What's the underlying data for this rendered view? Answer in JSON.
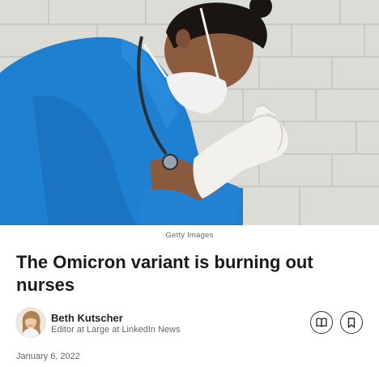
{
  "article": {
    "image_caption": "Getty Images",
    "title": "The Omicron variant is burning out nurses",
    "author": {
      "name": "Beth Kutscher",
      "role": "Editor at Large at LinkedIn News"
    },
    "date": "January 6, 2022"
  },
  "actions": {
    "read_icon": "open-book-icon",
    "save_icon": "bookmark-icon"
  },
  "colors": {
    "scrubs": "#1f7fd0",
    "wall": "#d9d9d4",
    "mask": "#f1f1f1"
  }
}
